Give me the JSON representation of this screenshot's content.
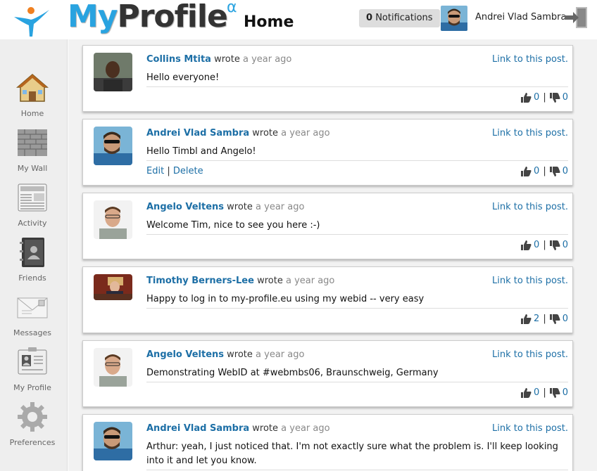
{
  "header": {
    "brand_my": "My",
    "brand_profile": "Profile",
    "brand_alpha": "α",
    "page_title": "Home",
    "notifications_count": "0",
    "notifications_label": "Notifications",
    "user_name": "Andrei Vlad Sambra"
  },
  "sidebar": {
    "items": [
      {
        "label": "Home",
        "icon": "home-icon"
      },
      {
        "label": "My Wall",
        "icon": "wall-icon"
      },
      {
        "label": "Activity",
        "icon": "newspaper-icon"
      },
      {
        "label": "Friends",
        "icon": "address-book-icon"
      },
      {
        "label": "Messages",
        "icon": "envelope-icon"
      },
      {
        "label": "My Profile",
        "icon": "profile-card-icon"
      },
      {
        "label": "Preferences",
        "icon": "gear-icon"
      }
    ]
  },
  "feed": {
    "wrote": "wrote",
    "link_label": "Link to this post.",
    "edit_label": "Edit",
    "delete_label": "Delete",
    "posts": [
      {
        "author": "Collins Mtita",
        "time": "a year ago",
        "text": "Hello everyone!",
        "likes": "0",
        "dislikes": "0"
      },
      {
        "author": "Andrei Vlad Sambra",
        "time": "a year ago",
        "text": "Hello Timbl and Angelo!",
        "likes": "0",
        "dislikes": "0"
      },
      {
        "author": "Angelo Veltens",
        "time": "a year ago",
        "text": "Welcome Tim, nice to see you here :-)",
        "likes": "0",
        "dislikes": "0"
      },
      {
        "author": "Timothy Berners-Lee",
        "time": "a year ago",
        "text": "Happy to log in to my-profile.eu using my webid -- very easy",
        "likes": "2",
        "dislikes": "0"
      },
      {
        "author": "Angelo Veltens",
        "time": "a year ago",
        "text": "Demonstrating WebID at #webmbs06, Braunschweig, Germany",
        "likes": "0",
        "dislikes": "0"
      },
      {
        "author": "Andrei Vlad Sambra",
        "time": "a year ago",
        "text": "Arthur: yeah, I just noticed that. I'm not exactly sure what the problem is. I'll keep looking into it and let you know."
      }
    ]
  },
  "colors": {
    "accent": "#29a3e0",
    "link": "#1d6fa6"
  }
}
